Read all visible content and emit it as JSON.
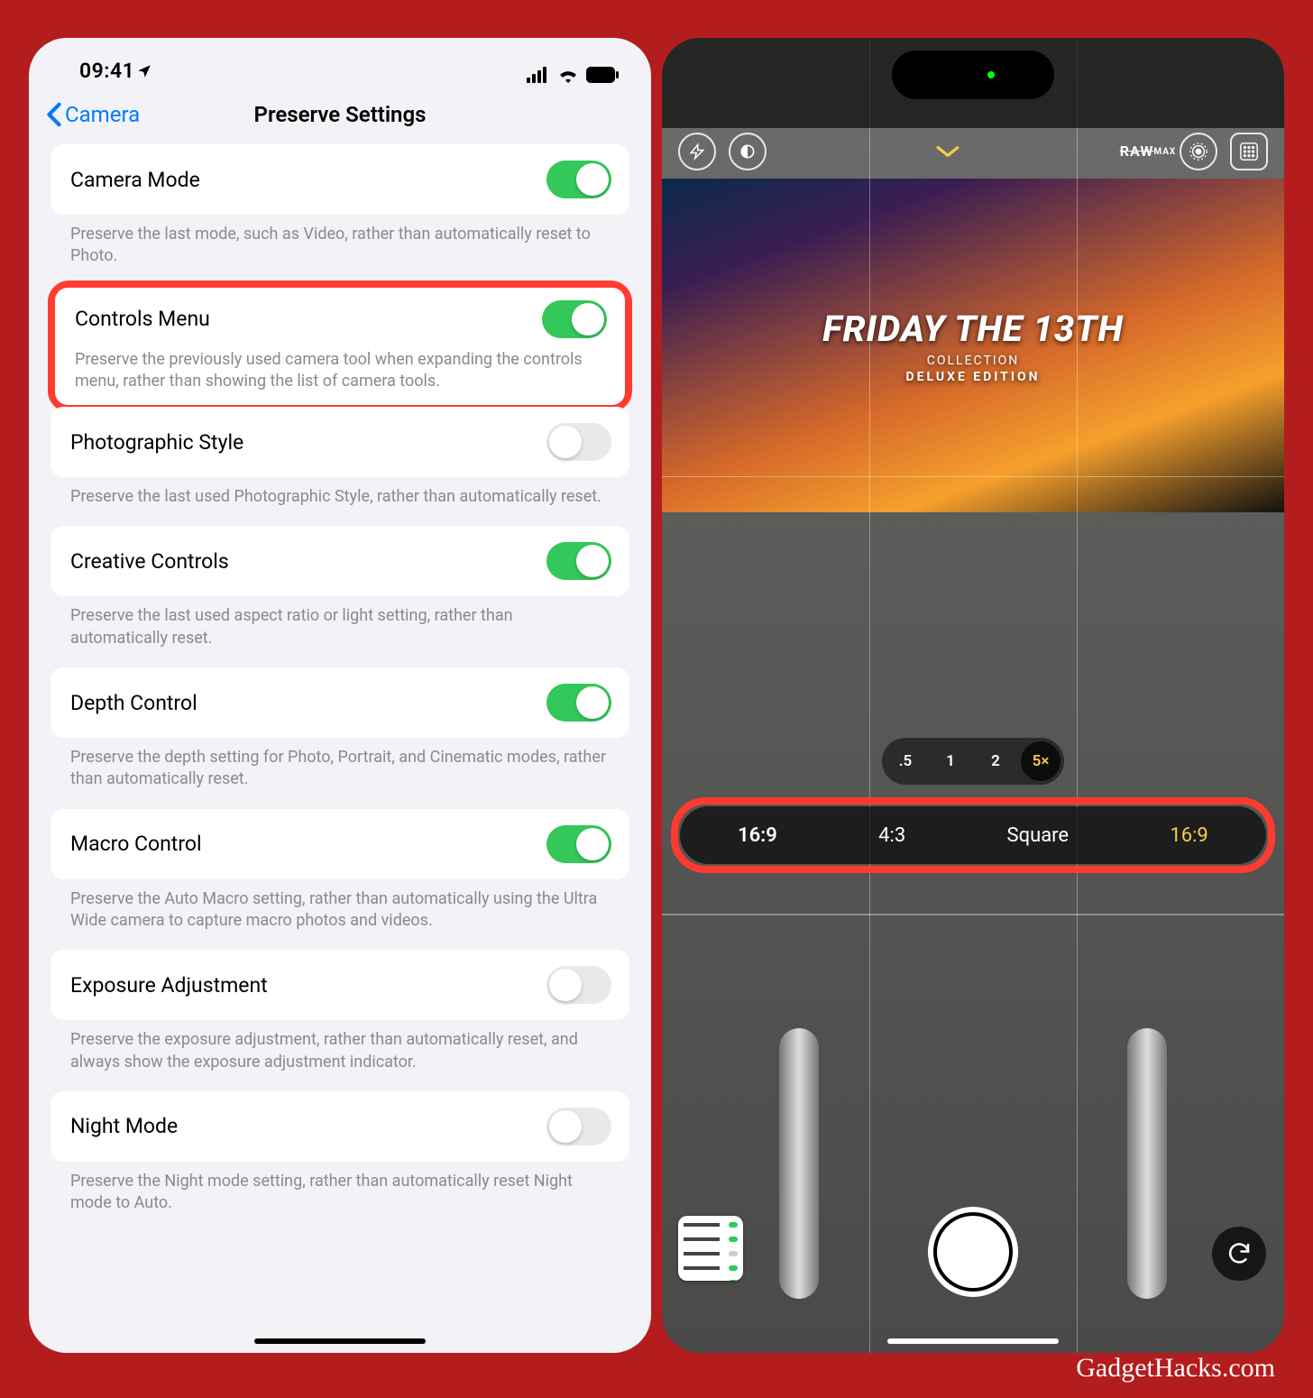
{
  "watermark": "GadgetHacks.com",
  "statusbar": {
    "time": "09:41"
  },
  "nav": {
    "back_label": "Camera",
    "title": "Preserve Settings"
  },
  "settings": [
    {
      "key": "camera_mode",
      "title": "Camera Mode",
      "on": true,
      "highlighted": false,
      "desc": "Preserve the last mode, such as Video, rather than automatically reset to Photo."
    },
    {
      "key": "controls_menu",
      "title": "Controls Menu",
      "on": true,
      "highlighted": true,
      "desc": "Preserve the previously used camera tool when expanding the controls menu, rather than showing the list of camera tools."
    },
    {
      "key": "photographic_style",
      "title": "Photographic Style",
      "on": false,
      "highlighted": false,
      "desc": "Preserve the last used Photographic Style, rather than automatically reset."
    },
    {
      "key": "creative_controls",
      "title": "Creative Controls",
      "on": true,
      "highlighted": false,
      "desc": "Preserve the last used aspect ratio or light setting, rather than automatically reset."
    },
    {
      "key": "depth_control",
      "title": "Depth Control",
      "on": true,
      "highlighted": false,
      "desc": "Preserve the depth setting for Photo, Portrait, and Cinematic modes, rather than automatically reset."
    },
    {
      "key": "macro_control",
      "title": "Macro Control",
      "on": true,
      "highlighted": false,
      "desc": "Preserve the Auto Macro setting, rather than automatically using the Ultra Wide camera to capture macro photos and videos."
    },
    {
      "key": "exposure_adjustment",
      "title": "Exposure Adjustment",
      "on": false,
      "highlighted": false,
      "desc": "Preserve the exposure adjustment, rather than automatically reset, and always show the exposure adjustment indicator."
    },
    {
      "key": "night_mode",
      "title": "Night Mode",
      "on": false,
      "highlighted": false,
      "desc": "Preserve the Night mode setting, rather than automatically reset Night mode to Auto."
    }
  ],
  "camera": {
    "raw_label": "RAW",
    "raw_sub": "MAX",
    "zoom_levels": [
      ".5",
      "1",
      "2",
      "5×"
    ],
    "zoom_selected": "5×",
    "aspect_current": "16:9",
    "aspect_options": [
      "4:3",
      "Square",
      "16:9"
    ],
    "aspect_selected": "16:9",
    "poster_title": "FRIDAY THE 13TH",
    "poster_sub1": "COLLECTION",
    "poster_sub2": "DELUXE EDITION"
  }
}
